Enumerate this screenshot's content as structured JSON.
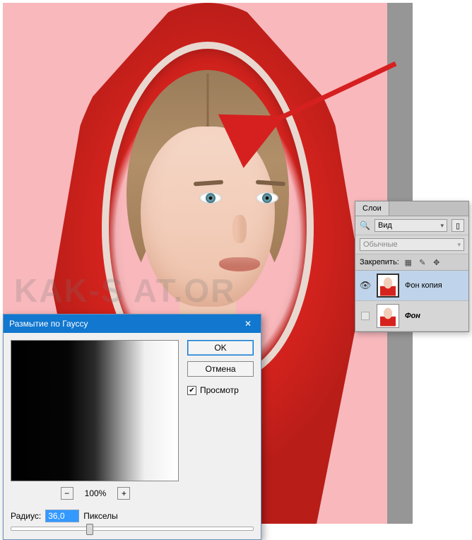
{
  "watermark": "KAK-S      AT.OR",
  "dialog": {
    "title": "Размытие по Гауссу",
    "close_glyph": "✕",
    "zoom_out_glyph": "−",
    "zoom_in_glyph": "+",
    "zoom_label": "100%",
    "ok_label": "OK",
    "cancel_label": "Отмена",
    "preview_label": "Просмотр",
    "preview_check": "✔",
    "radius_label": "Радиус:",
    "radius_value": "36,0",
    "radius_unit": "Пикселы"
  },
  "layers_panel": {
    "tab_label": "Слои",
    "search_kind": "Вид",
    "blend_mode": "Обычные",
    "lock_label": "Закрепить:",
    "lock_icons": {
      "transparency": "▦",
      "brush": "✎",
      "move": "✥"
    },
    "layers": [
      {
        "name": "Фон копия",
        "visible": true,
        "selected": true,
        "bold": false
      },
      {
        "name": "Фон",
        "visible": false,
        "selected": false,
        "bold": true
      }
    ]
  }
}
